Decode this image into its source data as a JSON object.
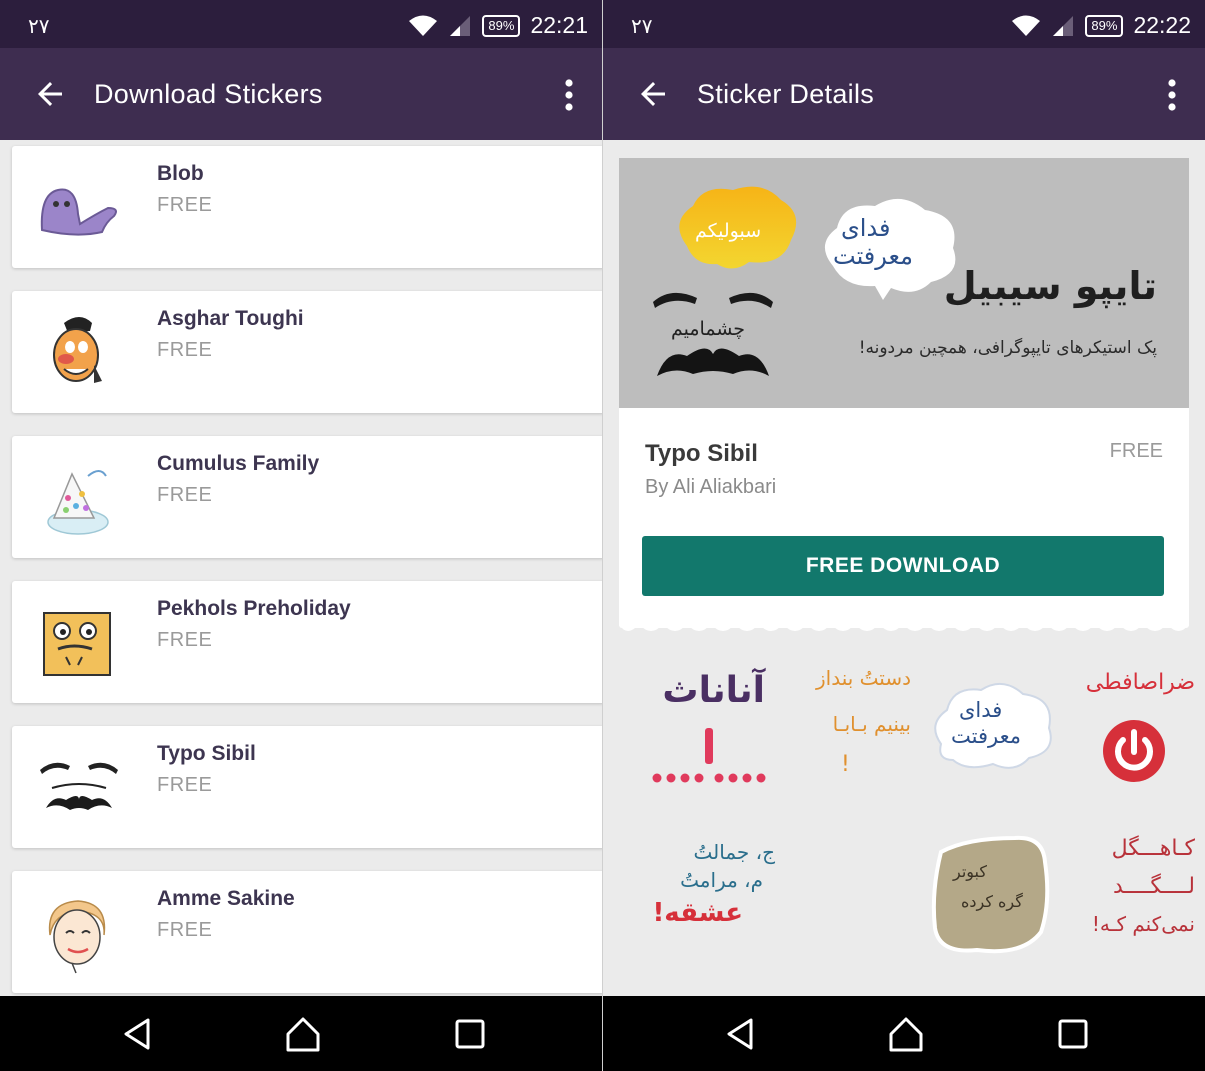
{
  "colors": {
    "statusbar": "#2c1e3d",
    "appbar": "#3e2d50",
    "accent_button": "#12786c",
    "background": "#ebebeb"
  },
  "left_screen": {
    "status": {
      "notif": "۲۷",
      "battery": "89%",
      "time": "22:21"
    },
    "appbar": {
      "title": "Download Stickers",
      "back_icon": "arrow-left-icon",
      "menu_icon": "more-vert-icon"
    },
    "items": [
      {
        "name": "Blob",
        "price": "FREE",
        "icon": "blob-sticker"
      },
      {
        "name": "Asghar Toughi",
        "price": "FREE",
        "icon": "asghar-sticker"
      },
      {
        "name": "Cumulus Family",
        "price": "FREE",
        "icon": "cumulus-sticker"
      },
      {
        "name": "Pekhols Preholiday",
        "price": "FREE",
        "icon": "pekhols-sticker"
      },
      {
        "name": "Typo Sibil",
        "price": "FREE",
        "icon": "mustache-sticker"
      },
      {
        "name": "Amme Sakine",
        "price": "FREE",
        "icon": "amme-sticker"
      }
    ]
  },
  "right_screen": {
    "status": {
      "notif": "۲۷",
      "battery": "89%",
      "time": "22:22"
    },
    "appbar": {
      "title": "Sticker Details",
      "back_icon": "arrow-left-icon",
      "menu_icon": "more-vert-icon"
    },
    "banner": {
      "title_fa": "تایپو سیبیل",
      "subtitle_fa": "پک استیکرهای تایپوگرافی، همچین مردونه!",
      "cloud_fa_1": "فدای",
      "cloud_fa_2": "معرفتت",
      "bubble_fa": "سبولیکم",
      "mustache_fa": "چشمامیم"
    },
    "details": {
      "name": "Typo Sibil",
      "author": "By Ali Aliakbari",
      "price": "FREE",
      "button": "FREE DOWNLOAD"
    },
    "stickers": {
      "s1_text": "آناناث",
      "s2_line1": "دستتُ بنداز",
      "s2_line2": "بینیم بـابـا",
      "s2_line3": "!",
      "s3_line1": "فدای",
      "s3_line2": "معرفتت",
      "s4_text": "ضراصافطی",
      "s5_line1": "ج، جمالتُ",
      "s5_line2": "م، مرامتُ",
      "s5_line3": "عشقه!",
      "s6_line1": "کبوتر",
      "s6_line2": "گره کرده",
      "s7_line1": "کـاهـــگل",
      "s7_line2": "لــــگــــد",
      "s7_line3": "نمی‌کنم کـه!"
    }
  }
}
